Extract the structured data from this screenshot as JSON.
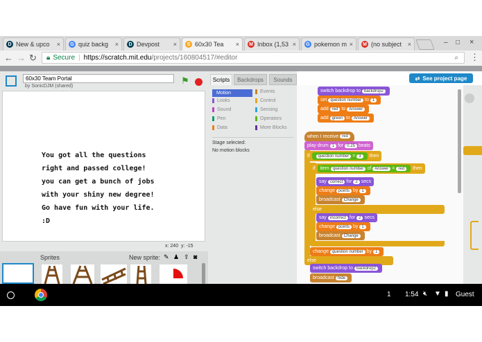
{
  "browser": {
    "tabs": [
      {
        "label": "New & upco",
        "icon": "devpost-icon",
        "active": false
      },
      {
        "label": "quiz backg",
        "icon": "google-icon",
        "active": false
      },
      {
        "label": "Devpost",
        "icon": "devpost-icon",
        "active": false
      },
      {
        "label": "60x30 Tea",
        "icon": "scratch-icon",
        "active": true
      },
      {
        "label": "Inbox (1,53",
        "icon": "gmail-icon",
        "active": false
      },
      {
        "label": "pokemon m",
        "icon": "google-icon",
        "active": false
      },
      {
        "label": "(no subject",
        "icon": "gmail-icon",
        "active": false
      }
    ],
    "secure_label": "Secure",
    "url_prefix": "https://scratch.mit.edu",
    "url_path": "/projects/160804517/#editor"
  },
  "scratch": {
    "project_title": "60x30 Team Portal",
    "author": "by SonicDJM (shared)",
    "stage_message": "You got all the questions\nright and passed college!\nyou can get a bunch of jobs\nwith your shiny new degree!\nGo have fun with your life.\n:D",
    "mouse_x_label": "x:",
    "mouse_x": "240",
    "mouse_y_label": "y:",
    "mouse_y": "-15",
    "sprites_label": "Sprites",
    "new_sprite_label": "New sprite:",
    "tabs": [
      "Scripts",
      "Backdrops",
      "Sounds"
    ],
    "see_project_page": "See project page",
    "categories_left": [
      "Motion",
      "Looks",
      "Sound",
      "Pen",
      "Data"
    ],
    "categories_right": [
      "Events",
      "Control",
      "Sensing",
      "Operators",
      "More Blocks"
    ],
    "stage_selected": "Stage selected:",
    "no_motion_blocks": "No motion blocks",
    "blocks": {
      "switch_backdrop_1": "switch backdrop to",
      "backdrop_1_arg": "backdrop2",
      "set_label": "set",
      "set_var": "question number",
      "set_to": "to",
      "set_val": "1",
      "add1": "add",
      "add1_val": "red",
      "add1_to": "to",
      "add1_list": "Answer",
      "add2": "add",
      "add2_val": "green",
      "add2_to": "to",
      "add2_list": "Answer",
      "when_receive": "when I receive",
      "when_receive_arg": "red",
      "play_drum": "play drum",
      "drum_val": "1",
      "for_label": "for",
      "beats_val": "0.25",
      "beats_label": "beats",
      "if_label": "if",
      "q_num": "question number",
      "eq_val": "3",
      "then_label": "then",
      "if2_label": "if",
      "item_label": "item",
      "item_var": "question number",
      "of_label": "of",
      "item_list": "Answer",
      "eq2_val": "red",
      "then2_label": "then",
      "say1": "say",
      "say1_val": "correct",
      "say1_for": "for",
      "say1_secs": "2",
      "say1_secs_label": "secs",
      "change1": "change",
      "change1_var": "points",
      "change1_by": "by",
      "change1_val": "1",
      "broadcast1": "broadcast",
      "broadcast1_val": "Change",
      "else1": "else",
      "say2": "say",
      "say2_val": "incorrect",
      "say2_for": "for",
      "say2_secs": "2",
      "say2_secs_label": "secs",
      "change2": "change",
      "change2_var": "points",
      "change2_by": "by",
      "change2_val": "1",
      "broadcast2": "broadcast",
      "broadcast2_val": "Change",
      "change3": "change",
      "change3_var": "question number",
      "change3_by": "by",
      "change3_val": "1",
      "else2": "else",
      "switch_backdrop_2": "switch backdrop to",
      "backdrop_2_arg": "backdrop2",
      "broadcast3": "broadcast",
      "broadcast3_val": "hide"
    }
  },
  "taskbar": {
    "notification_count": "1",
    "time": "1:54",
    "user": "Guest"
  }
}
